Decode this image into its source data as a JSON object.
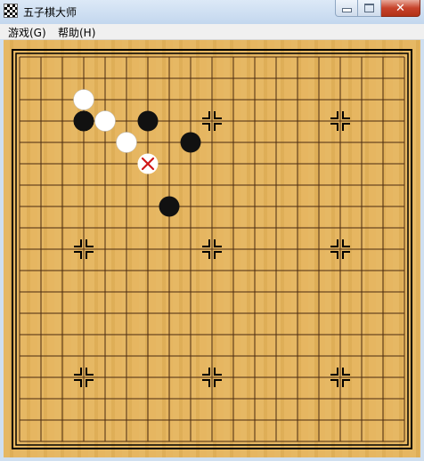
{
  "window": {
    "title": "五子棋大师",
    "buttons": {
      "minimize": "minimize",
      "maximize": "maximize",
      "close": "close"
    }
  },
  "menu": {
    "items": [
      {
        "label": "游戏(G)"
      },
      {
        "label": "帮助(H)"
      }
    ]
  },
  "board": {
    "size": 19,
    "star_points": [
      [
        3,
        3
      ],
      [
        9,
        3
      ],
      [
        15,
        3
      ],
      [
        3,
        9
      ],
      [
        9,
        9
      ],
      [
        15,
        9
      ],
      [
        3,
        15
      ],
      [
        9,
        15
      ],
      [
        15,
        15
      ]
    ],
    "stones": [
      {
        "color": "white",
        "col": 3,
        "row": 2
      },
      {
        "color": "black",
        "col": 3,
        "row": 3
      },
      {
        "color": "white",
        "col": 4,
        "row": 3
      },
      {
        "color": "black",
        "col": 6,
        "row": 3
      },
      {
        "color": "white",
        "col": 5,
        "row": 4
      },
      {
        "color": "black",
        "col": 8,
        "row": 4
      },
      {
        "color": "black",
        "col": 7,
        "row": 7
      }
    ],
    "last_move_marker": {
      "col": 6,
      "row": 5,
      "icon": "red-x-icon"
    },
    "colors": {
      "wood": "#e5b45c",
      "line": "#4a2a10",
      "black_stone": "#111111",
      "white_stone": "#ffffff",
      "marker": "#d01818"
    }
  }
}
